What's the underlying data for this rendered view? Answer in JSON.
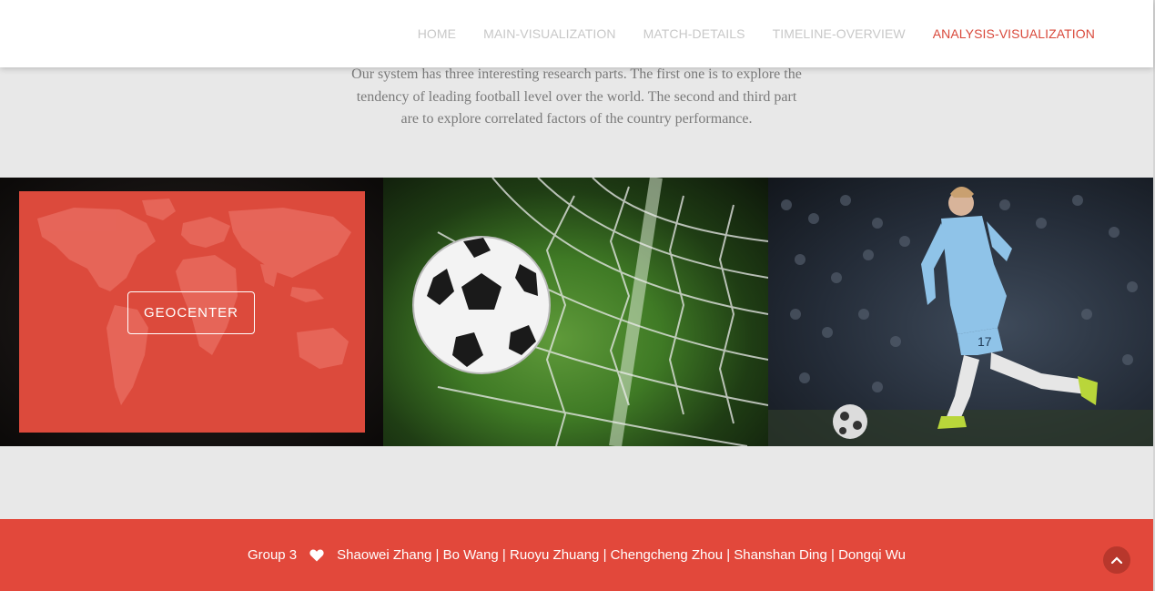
{
  "nav": {
    "links": [
      {
        "label": "HOME",
        "active": false
      },
      {
        "label": "MAIN-VISUALIZATION",
        "active": false
      },
      {
        "label": "MATCH-DETAILS",
        "active": false
      },
      {
        "label": "TIMELINE-OVERVIEW",
        "active": false
      },
      {
        "label": "ANALYSIS-VISUALIZATION",
        "active": true
      }
    ]
  },
  "intro": {
    "text": "Our system has three interesting research parts. The first one is to explore the tendency of leading football level over the world. The second and third part are to explore correlated factors of the country performance."
  },
  "panels": {
    "geocenter_label": "GEOCENTER",
    "items": [
      {
        "image": "world-map-image"
      },
      {
        "image": "soccer-ball-net-image"
      },
      {
        "image": "soccer-player-image"
      }
    ]
  },
  "footer": {
    "group": "Group 3",
    "heart_icon": "heart-icon",
    "members": "Shaowei Zhang | Bo Wang | Ruoyu Zhuang | Chengcheng Zhou | Shanshan Ding | Dongqi Wu"
  },
  "colors": {
    "accent": "#e2483b",
    "nav_inactive": "#c8c8c8",
    "background": "#e8e8e8"
  }
}
